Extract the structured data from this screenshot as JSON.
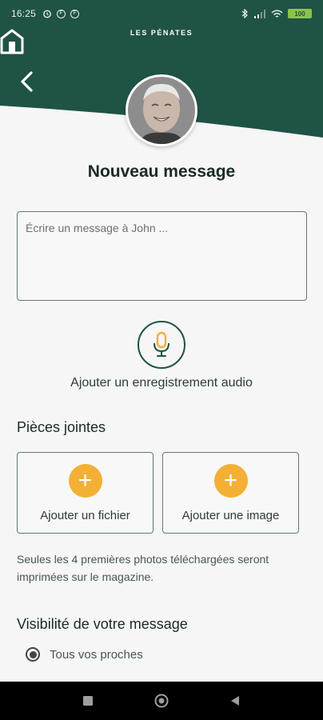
{
  "status_bar": {
    "time": "16:25",
    "notification_icons": [
      "alarm-icon",
      "app-notification-icon",
      "app-notification-icon"
    ],
    "battery_label": "100"
  },
  "brand": {
    "name": "LES PÉNATES"
  },
  "header": {
    "bg_color": "#1f5346"
  },
  "recipient": {
    "avatar": "recipient-avatar"
  },
  "page": {
    "title": "Nouveau message"
  },
  "message": {
    "placeholder": "Écrire un message à John ..."
  },
  "audio": {
    "label": "Ajouter un enregistrement audio"
  },
  "attachments": {
    "title": "Pièces jointes",
    "add_file_label": "Ajouter un fichier",
    "add_image_label": "Ajouter une image",
    "note": "Seules les 4 premières photos téléchargées seront imprimées sur le magazine."
  },
  "visibility": {
    "title": "Visibilité de votre message",
    "options": [
      {
        "label": "Tous vos proches",
        "selected": true
      }
    ]
  },
  "colors": {
    "accent": "#f4b035",
    "primary": "#1f5346"
  }
}
